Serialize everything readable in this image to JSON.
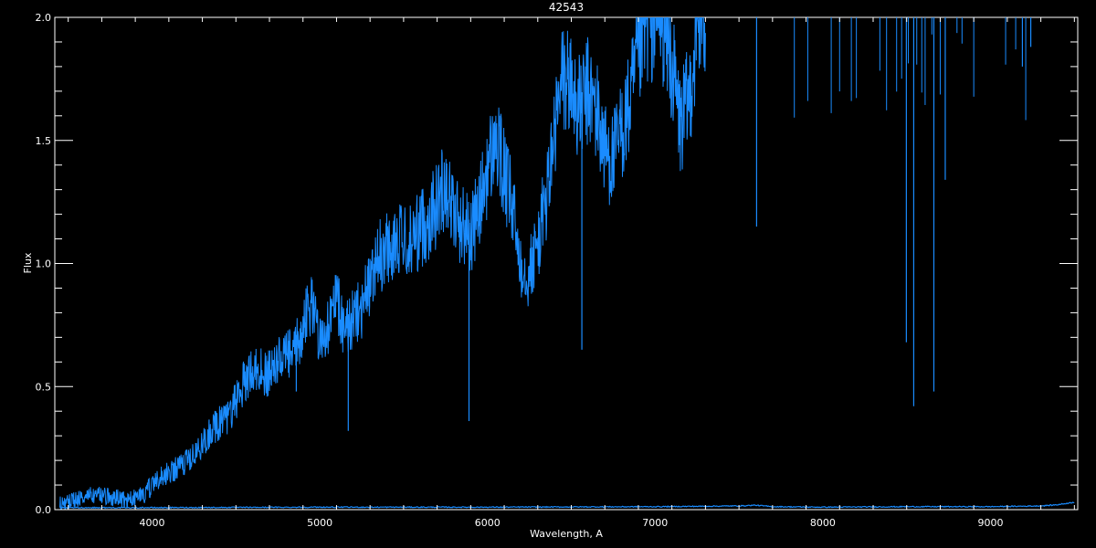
{
  "chart_data": {
    "type": "line",
    "title": "42543",
    "xlabel": "Wavelength, A",
    "ylabel": "Flux",
    "xlim": [
      3420,
      9520
    ],
    "ylim": [
      0.0,
      2.0
    ],
    "x_ticks": [
      4000,
      5000,
      6000,
      7000,
      8000,
      9000
    ],
    "y_ticks": [
      0.0,
      0.5,
      1.0,
      1.5,
      2.0
    ],
    "y_tick_labels": [
      "0.0",
      "0.5",
      "1.0",
      "1.5",
      "2.0"
    ],
    "grid": false,
    "colors": {
      "background": "#000000",
      "axes": "#ffffff",
      "series": "#1a8cff"
    },
    "series": [
      {
        "values_xy": [
          [
            3450,
            0.02
          ],
          [
            3500,
            0.03
          ],
          [
            3550,
            0.04
          ],
          [
            3600,
            0.05
          ],
          [
            3650,
            0.06
          ],
          [
            3700,
            0.06
          ],
          [
            3750,
            0.05
          ],
          [
            3800,
            0.05
          ],
          [
            3850,
            0.04
          ],
          [
            3900,
            0.05
          ],
          [
            3950,
            0.06
          ],
          [
            4000,
            0.1
          ],
          [
            4050,
            0.13
          ],
          [
            4100,
            0.15
          ],
          [
            4150,
            0.17
          ],
          [
            4200,
            0.19
          ],
          [
            4250,
            0.22
          ],
          [
            4300,
            0.26
          ],
          [
            4350,
            0.33
          ],
          [
            4400,
            0.35
          ],
          [
            4450,
            0.37
          ],
          [
            4500,
            0.45
          ],
          [
            4550,
            0.52
          ],
          [
            4600,
            0.58
          ],
          [
            4650,
            0.56
          ],
          [
            4700,
            0.55
          ],
          [
            4750,
            0.6
          ],
          [
            4800,
            0.62
          ],
          [
            4850,
            0.64
          ],
          [
            4900,
            0.74
          ],
          [
            4950,
            0.85
          ],
          [
            5000,
            0.7
          ],
          [
            5050,
            0.74
          ],
          [
            5100,
            0.86
          ],
          [
            5150,
            0.72
          ],
          [
            5200,
            0.78
          ],
          [
            5250,
            0.82
          ],
          [
            5300,
            0.92
          ],
          [
            5350,
            1.02
          ],
          [
            5400,
            1.06
          ],
          [
            5450,
            1.1
          ],
          [
            5500,
            1.07
          ],
          [
            5550,
            1.1
          ],
          [
            5600,
            1.14
          ],
          [
            5650,
            1.18
          ],
          [
            5700,
            1.24
          ],
          [
            5750,
            1.34
          ],
          [
            5800,
            1.2
          ],
          [
            5850,
            1.16
          ],
          [
            5900,
            1.12
          ],
          [
            5950,
            1.22
          ],
          [
            6000,
            1.38
          ],
          [
            6050,
            1.5
          ],
          [
            6100,
            1.36
          ],
          [
            6150,
            1.22
          ],
          [
            6200,
            1.0
          ],
          [
            6250,
            0.96
          ],
          [
            6300,
            1.08
          ],
          [
            6350,
            1.26
          ],
          [
            6400,
            1.52
          ],
          [
            6450,
            1.76
          ],
          [
            6500,
            1.72
          ],
          [
            6550,
            1.62
          ],
          [
            6600,
            1.7
          ],
          [
            6650,
            1.62
          ],
          [
            6700,
            1.46
          ],
          [
            6750,
            1.42
          ],
          [
            6800,
            1.54
          ],
          [
            6850,
            1.64
          ],
          [
            6900,
            1.84
          ],
          [
            6950,
            1.98
          ],
          [
            7000,
            2.0
          ],
          [
            7050,
            1.98
          ],
          [
            7100,
            1.8
          ],
          [
            7150,
            1.56
          ],
          [
            7200,
            1.66
          ],
          [
            7250,
            1.96
          ],
          [
            7300,
            2.0
          ]
        ],
        "absorption_lines": [
          [
            4340,
            0.3
          ],
          [
            4860,
            0.48
          ],
          [
            5170,
            0.32
          ],
          [
            5890,
            0.36
          ],
          [
            6563,
            0.65
          ],
          [
            7605,
            1.15
          ],
          [
            8498,
            0.68
          ],
          [
            8542,
            0.42
          ],
          [
            8662,
            0.48
          ],
          [
            8730,
            1.34
          ],
          [
            9190,
            1.8
          ],
          [
            9240,
            1.88
          ]
        ],
        "top_lines": [
          7830,
          7910,
          8050,
          8100,
          8170,
          8200,
          8340,
          8380,
          8440,
          8470,
          8510,
          8560,
          8590,
          8610,
          8650,
          8700,
          8800,
          8830,
          8900,
          9090,
          9150,
          9210
        ]
      },
      {
        "values_xy": [
          [
            3450,
            0.008
          ],
          [
            4000,
            0.008
          ],
          [
            5000,
            0.01
          ],
          [
            6000,
            0.01
          ],
          [
            7000,
            0.012
          ],
          [
            7500,
            0.015
          ],
          [
            7600,
            0.018
          ],
          [
            7700,
            0.012
          ],
          [
            8000,
            0.01
          ],
          [
            8500,
            0.012
          ],
          [
            9000,
            0.012
          ],
          [
            9300,
            0.015
          ],
          [
            9400,
            0.02
          ],
          [
            9500,
            0.03
          ]
        ]
      }
    ]
  }
}
